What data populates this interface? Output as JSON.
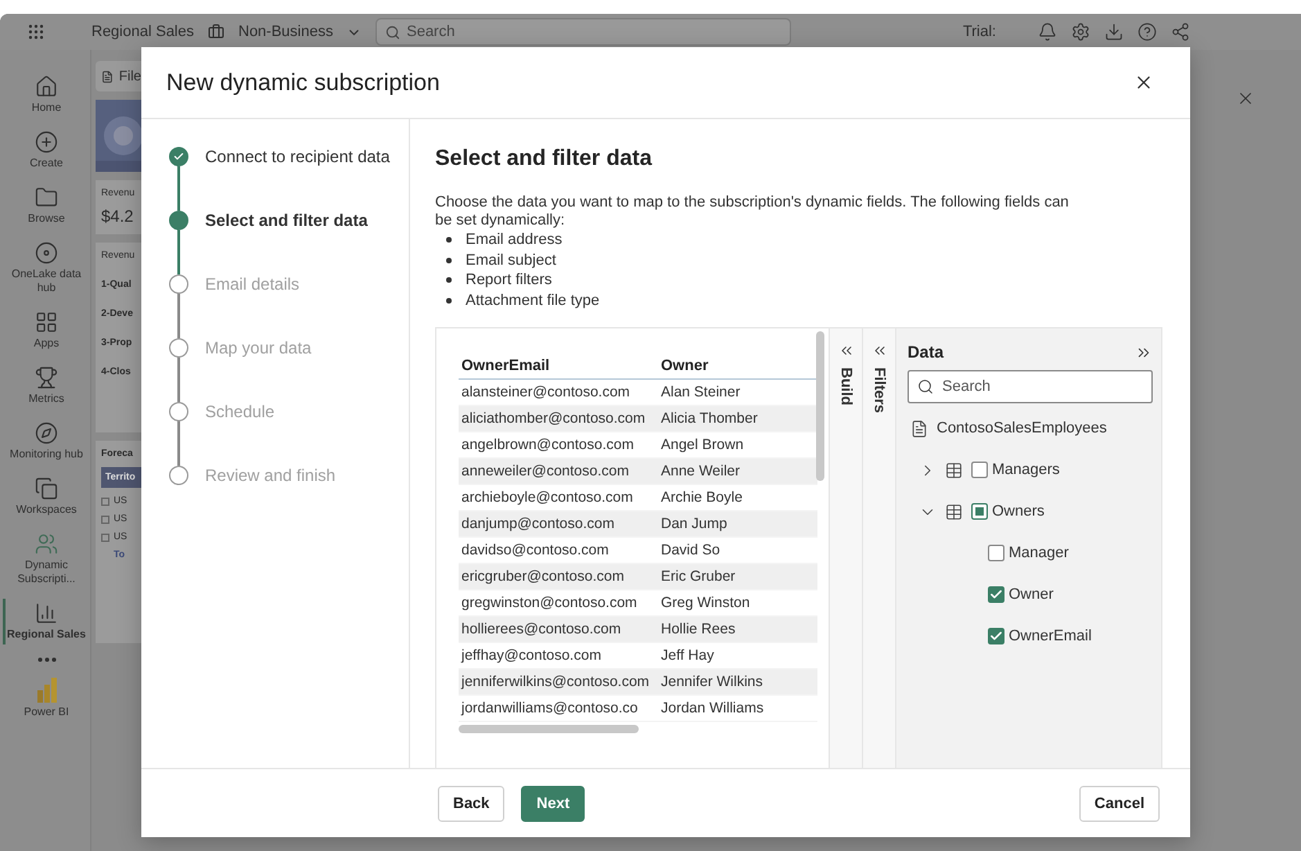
{
  "app": {
    "top_bar": {
      "workspace": "Regional Sales",
      "label": "Non-Business",
      "search_placeholder": "Search",
      "trial": "Trial:"
    },
    "nav": [
      {
        "label": "Home",
        "selected": false
      },
      {
        "label": "Create",
        "selected": false
      },
      {
        "label": "Browse",
        "selected": false
      },
      {
        "label": "OneLake data hub",
        "selected": false
      },
      {
        "label": "Apps",
        "selected": false
      },
      {
        "label": "Metrics",
        "selected": false
      },
      {
        "label": "Monitoring hub",
        "selected": false
      },
      {
        "label": "Workspaces",
        "selected": false
      },
      {
        "label": "Dynamic Subscripti...",
        "selected": false
      },
      {
        "label": "Regional Sales",
        "selected": true
      },
      {
        "selected": false
      },
      {
        "label": "Power BI",
        "selected": false
      }
    ],
    "report": {
      "tab": "File",
      "kpi": {
        "title": "Revenu",
        "value": "$4.2"
      },
      "funnel": {
        "title": "Revenu",
        "rows": [
          "1-Qual",
          "2-Deve",
          "3-Prop",
          "4-Clos"
        ]
      },
      "table": {
        "title": "Foreca",
        "header": "Territo",
        "rows": [
          "US",
          "US",
          "US"
        ],
        "total": "To"
      }
    }
  },
  "dialog": {
    "title": "New dynamic subscription",
    "steps": [
      {
        "label": "Connect to recipient data",
        "done": true,
        "selected": false
      },
      {
        "label": "Select and filter data",
        "done": false,
        "selected": true
      },
      {
        "label": "Email details",
        "done": false,
        "selected": false
      },
      {
        "label": "Map your data",
        "done": false,
        "selected": false
      },
      {
        "label": "Schedule",
        "done": false,
        "selected": false
      },
      {
        "label": "Review and finish",
        "done": false,
        "selected": false
      }
    ],
    "heading": "Select and filter data",
    "intro": "Choose the data you want to map to the subscription's dynamic fields. The following fields can be set dynamically:",
    "bullets": [
      "Email address",
      "Email subject",
      "Report filters",
      "Attachment file type"
    ],
    "table": {
      "columns": [
        "OwnerEmail",
        "Owner"
      ],
      "rows": [
        [
          "alansteiner@contoso.com",
          "Alan Steiner"
        ],
        [
          "aliciathomber@contoso.com",
          "Alicia Thomber"
        ],
        [
          "angelbrown@contoso.com",
          "Angel Brown"
        ],
        [
          "anneweiler@contoso.com",
          "Anne Weiler"
        ],
        [
          "archieboyle@contoso.com",
          "Archie Boyle"
        ],
        [
          "danjump@contoso.com",
          "Dan Jump"
        ],
        [
          "davidso@contoso.com",
          "David So"
        ],
        [
          "ericgruber@contoso.com",
          "Eric Gruber"
        ],
        [
          "gregwinston@contoso.com",
          "Greg Winston"
        ],
        [
          "hollierees@contoso.com",
          "Hollie Rees"
        ],
        [
          "jeffhay@contoso.com",
          "Jeff Hay"
        ],
        [
          "jenniferwilkins@contoso.com",
          "Jennifer Wilkins"
        ],
        [
          "jordanwilliams@contoso.co",
          "Jordan Williams"
        ]
      ]
    },
    "side_tabs": [
      "Build",
      "Filters"
    ],
    "data_pane": {
      "title": "Data",
      "search_placeholder": "Search",
      "model": "ContosoSalesEmployees",
      "tables": [
        {
          "name": "Managers",
          "expanded": false,
          "checked": false,
          "partial": false
        },
        {
          "name": "Owners",
          "expanded": true,
          "checked": false,
          "partial": true,
          "fields": [
            {
              "name": "Manager",
              "checked": false
            },
            {
              "name": "Owner",
              "checked": true
            },
            {
              "name": "OwnerEmail",
              "checked": true
            }
          ]
        }
      ]
    },
    "buttons": {
      "back": "Back",
      "next": "Next",
      "cancel": "Cancel"
    }
  }
}
